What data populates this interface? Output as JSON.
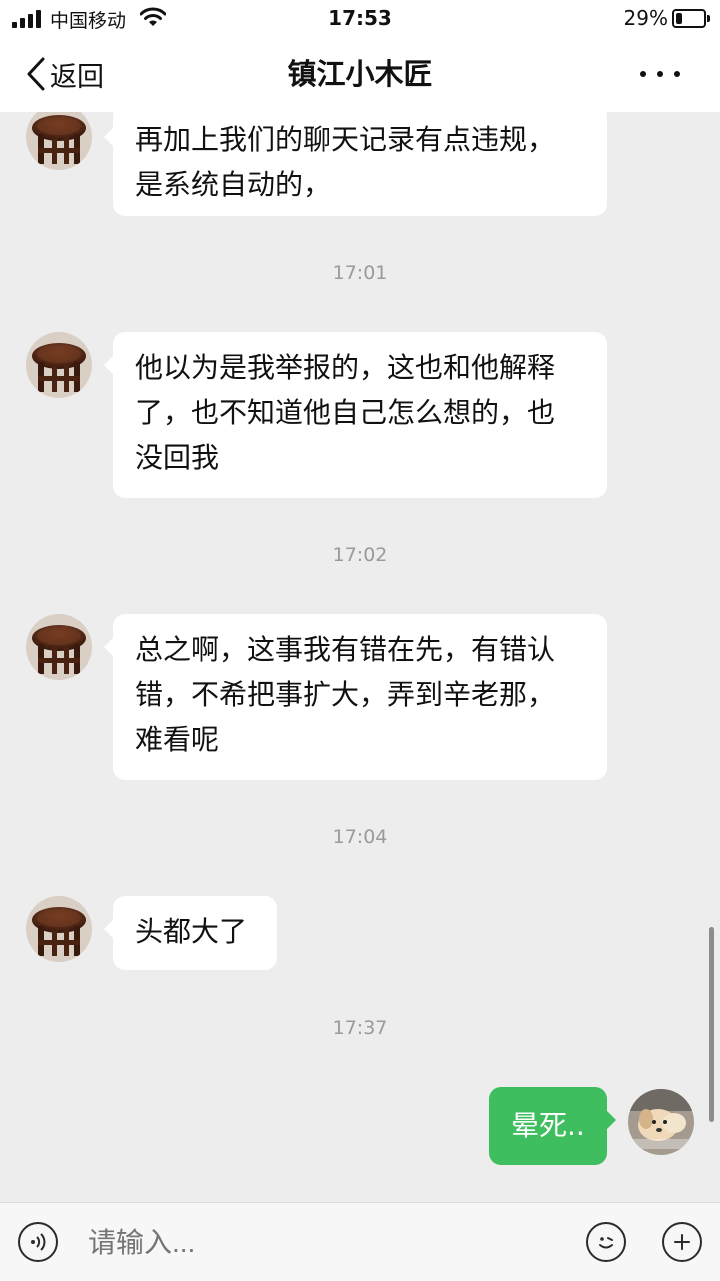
{
  "status_bar": {
    "carrier": "中国移动",
    "time": "17:53",
    "battery_percent": "29%",
    "battery_level": 0.29,
    "signal_icon": "signal-bars-icon",
    "wifi_icon": "wifi-icon",
    "battery_icon": "battery-icon"
  },
  "nav": {
    "back_label": "返回",
    "title": "镇江小木匠",
    "back_icon": "chevron-left-icon",
    "more_icon": "more-dots-icon"
  },
  "messages": [
    {
      "type": "incoming",
      "lines": [
        "再加上我们的聊天记录有点违规，",
        "是系统自动的，"
      ]
    },
    {
      "type": "time",
      "text": "17:01"
    },
    {
      "type": "incoming",
      "lines": [
        "他以为是我举报的，这也和他解释",
        "了，也不知道他自己怎么想的，也",
        "没回我"
      ]
    },
    {
      "type": "time",
      "text": "17:02"
    },
    {
      "type": "incoming",
      "lines": [
        "总之啊，这事我有错在先，有错认",
        "错，不希把事扩大，弄到辛老那，",
        "难看呢"
      ]
    },
    {
      "type": "time",
      "text": "17:04"
    },
    {
      "type": "incoming",
      "lines": [
        "头都大了"
      ]
    },
    {
      "type": "time",
      "text": "17:37"
    },
    {
      "type": "outgoing",
      "lines": [
        "晕死.."
      ]
    }
  ],
  "input_bar": {
    "placeholder": "请输入...",
    "voice_icon": "voice-icon",
    "emoji_icon": "emoji-icon",
    "plus_icon": "plus-icon"
  },
  "colors": {
    "outgoing_bubble": "#3fbe5f",
    "incoming_bubble": "#ffffff",
    "chat_background": "#ededed",
    "timestamp_text": "#9a9a9a"
  }
}
